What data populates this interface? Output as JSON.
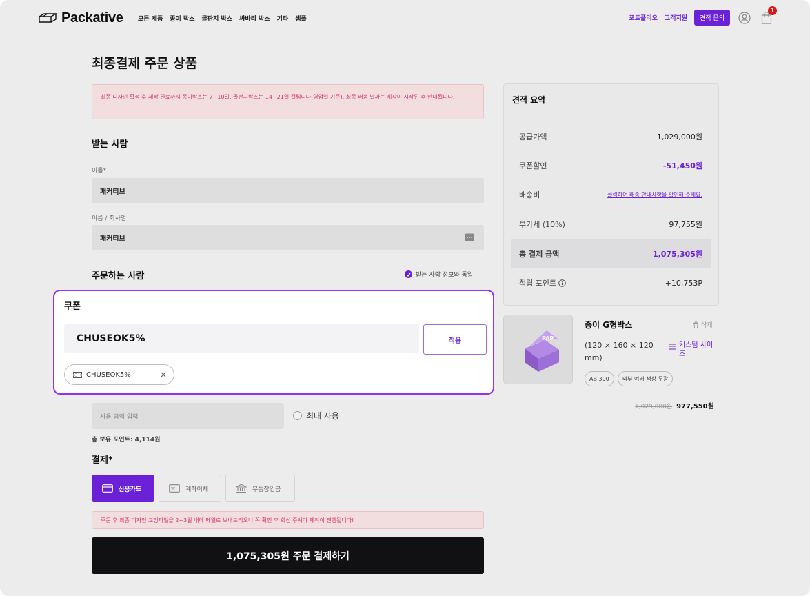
{
  "header": {
    "logo": "Packative",
    "nav": [
      "모든 제품",
      "종이 박스",
      "골판지 박스",
      "싸바리 박스",
      "기타",
      "샘플"
    ],
    "portfolio": "포트폴리오",
    "support": "고객지원",
    "quote_button": "견적 문의",
    "cart_count": "1"
  },
  "page": {
    "title": "최종결제 주문 상품",
    "notice": "최종 디자인 확정 후 제작 완료까지 종이박스는 7~10일, 골판지박스는 14~21일 걸립니다(영업일 기준). 최종 배송 날짜는 제작이 시작된 후 안내됩니다."
  },
  "recipient": {
    "title": "받는 사람",
    "name_label": "이름*",
    "name_value": "패커티브",
    "company_label": "이름 / 회사명",
    "company_value": "패커티브"
  },
  "orderer": {
    "title": "주문하는 사람",
    "same_as_label": "받는 사람 정보와 동일"
  },
  "coupon": {
    "title": "쿠폰",
    "input_value": "CHUSEOK5%",
    "apply_button": "적용",
    "applied_chip": "CHUSEOK5%",
    "remove": "×"
  },
  "points": {
    "placeholder": "사용 금액 입력",
    "max_use": "최대 사용",
    "held": "총 보유 포인트:  4,114원"
  },
  "payment": {
    "title": "결제*",
    "methods": [
      "신용카드",
      "계좌이체",
      "무통장입금"
    ],
    "notice": "주문 후 최종 디자인 교정파일을 2~3일 내에 메일로 보내드리오니 꼭 확인 후 회신 주셔야 제작이 진행됩니다!",
    "submit": "1,075,305원 주문 결제하기"
  },
  "summary": {
    "title": "견적 요약",
    "rows": [
      {
        "label": "공급가액",
        "value": "1,029,000원"
      },
      {
        "label": "쿠폰할인",
        "value": "-51,450원"
      },
      {
        "label": "배송비",
        "value": "클릭하여 배송 안내사항을 확인해 주세요."
      },
      {
        "label": "부가세 (10%)",
        "value": "97,755원"
      },
      {
        "label": "총 결제 금액",
        "value": "1,075,305원"
      },
      {
        "label": "적립 포인트",
        "value": "+10,753P"
      }
    ]
  },
  "product": {
    "name": "종이 G형박스",
    "delete": "삭제",
    "size": "(120 × 160 × 120 mm)",
    "custom_size": "커스텀 사이즈",
    "chips": [
      "AB 300",
      "외부 여러 색상 무광"
    ],
    "old_price": "1,029,000원",
    "new_price": "977,550원"
  },
  "colors": {
    "accent": "#6b21d6",
    "notice_text": "#d6336c",
    "notice_bg": "#f2dede"
  }
}
